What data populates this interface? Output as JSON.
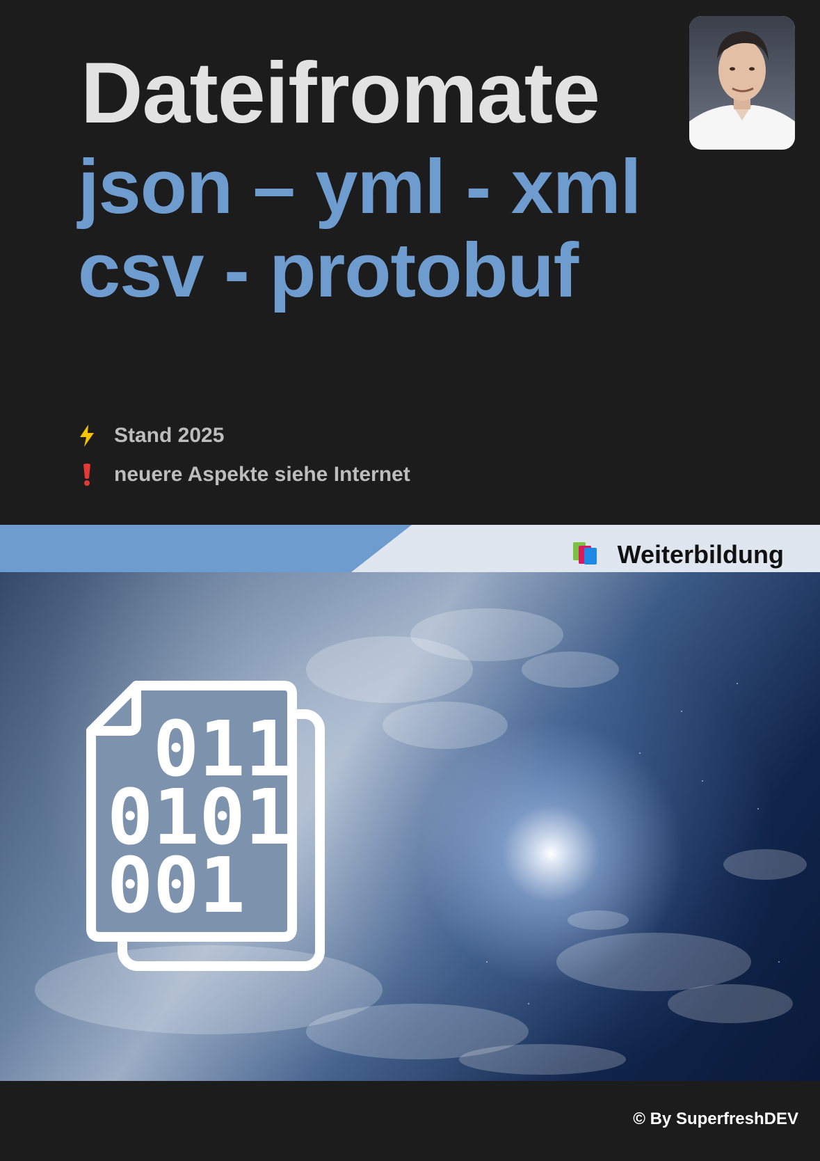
{
  "header": {
    "title": "Dateifromate",
    "subtitle_line1": "json – yml - xml",
    "subtitle_line2": "csv - protobuf"
  },
  "notes": [
    {
      "icon": "lightning-icon",
      "text": "Stand 2025"
    },
    {
      "icon": "exclamation-icon",
      "text": "neuere Aspekte siehe Internet"
    }
  ],
  "badge": {
    "icon": "books-icon",
    "label": "Weiterbildung"
  },
  "hero": {
    "icon": "binary-file-icon",
    "lines": [
      "011",
      "0101",
      "001"
    ]
  },
  "footer": {
    "credit": "© By SuperfreshDEV"
  },
  "colors": {
    "background": "#1c1c1d",
    "accent_blue": "#6f9ccf",
    "band_light": "#dfe6ef",
    "title_text": "#e2e2e2"
  }
}
